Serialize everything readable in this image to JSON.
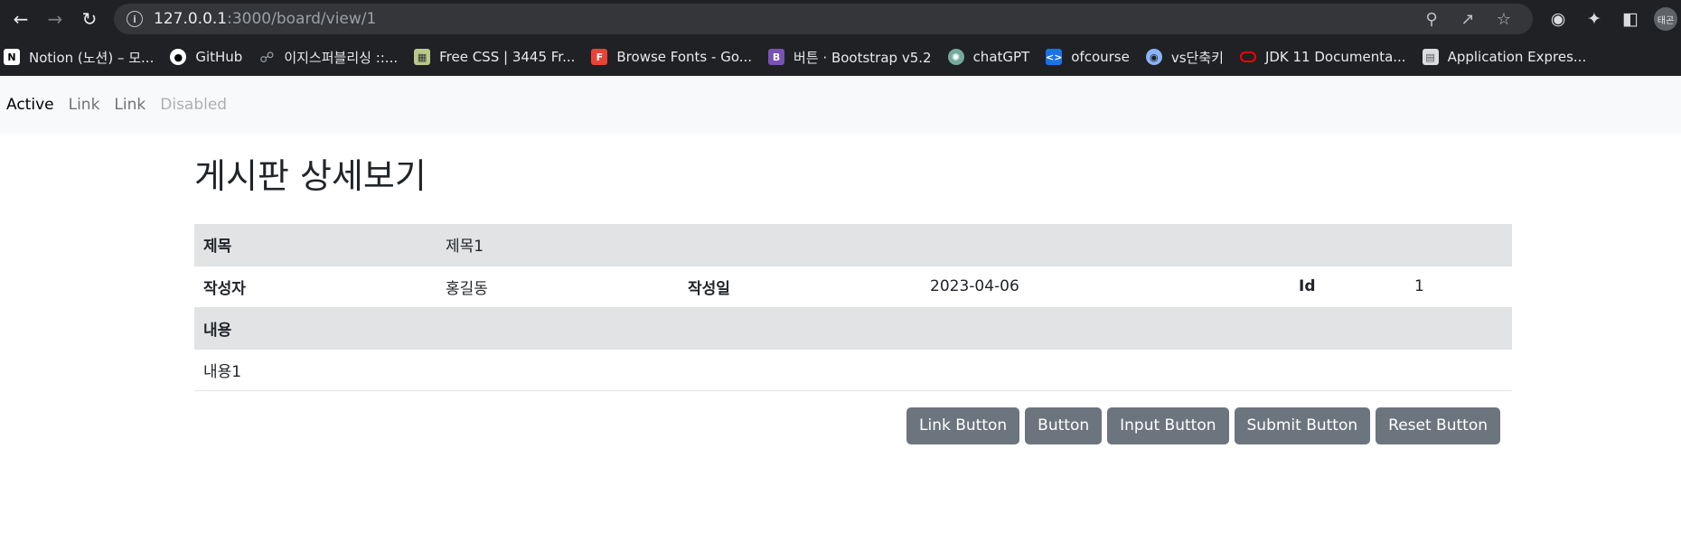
{
  "browser": {
    "url_host": "127.0.0.1",
    "url_path": ":3000/board/view/1",
    "avatar_label": "태곤",
    "bookmarks": [
      {
        "label": "Notion (노션) – 모...",
        "icon": "notion-icon",
        "color": "#ffffff"
      },
      {
        "label": "GitHub",
        "icon": "github-icon",
        "color": "#ffffff"
      },
      {
        "label": "이지스퍼블리싱 ::...",
        "icon": "globe-icon",
        "color": "#9aa0a6"
      },
      {
        "label": "Free CSS | 3445 Fr...",
        "icon": "freecss-icon",
        "color": "#b9c98a"
      },
      {
        "label": "Browse Fonts - Go...",
        "icon": "google-fonts-icon",
        "color": "#ea4335"
      },
      {
        "label": "버튼 · Bootstrap v5.2",
        "icon": "bootstrap-icon",
        "color": "#7952b3"
      },
      {
        "label": "chatGPT",
        "icon": "chatgpt-icon",
        "color": "#74aa9c"
      },
      {
        "label": "ofcourse",
        "icon": "ofcourse-icon",
        "color": "#1a73e8"
      },
      {
        "label": "vs단축키",
        "icon": "vs-icon",
        "color": "#8ab4f8"
      },
      {
        "label": "JDK 11 Documenta...",
        "icon": "oracle-icon",
        "color": "#f80000"
      },
      {
        "label": "Application Expres...",
        "icon": "app-express-icon",
        "color": "#dadce0"
      }
    ]
  },
  "navbar": {
    "links": [
      {
        "label": "Active",
        "state": "active"
      },
      {
        "label": "Link",
        "state": "normal"
      },
      {
        "label": "Link",
        "state": "normal"
      },
      {
        "label": "Disabled",
        "state": "disabled"
      }
    ]
  },
  "page": {
    "title": "게시판 상세보기",
    "labels": {
      "title": "제목",
      "author": "작성자",
      "date": "작성일",
      "id": "Id",
      "content": "내용"
    },
    "post": {
      "title": "제목1",
      "author": "홍길동",
      "date": "2023-04-06",
      "id": "1",
      "content": "내용1"
    },
    "buttons": [
      "Link Button",
      "Button",
      "Input Button",
      "Submit Button",
      "Reset Button"
    ]
  },
  "colors": {
    "chrome_bg": "#202124",
    "row_shade": "#e2e3e5",
    "button_bg": "#6c757d"
  }
}
